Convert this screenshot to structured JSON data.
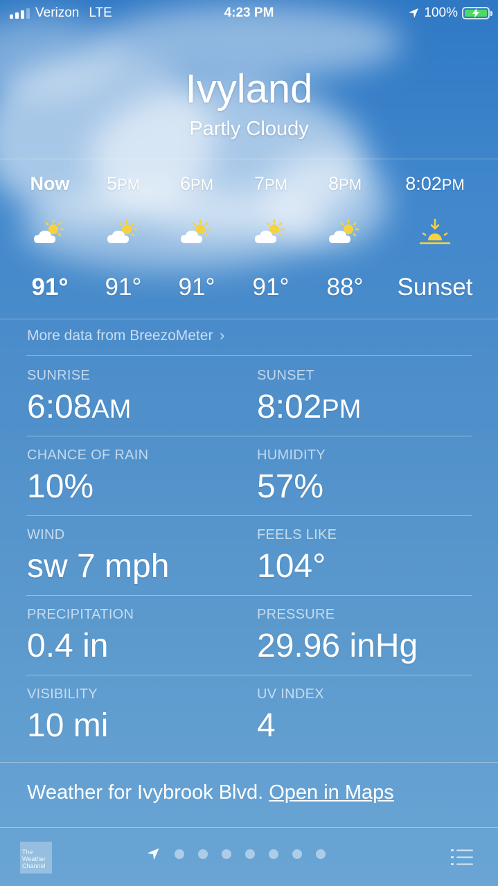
{
  "status_bar": {
    "carrier": "Verizon",
    "network": "LTE",
    "time": "4:23 PM",
    "battery": "100%"
  },
  "location": {
    "city": "Ivyland",
    "condition": "Partly Cloudy"
  },
  "hourly": [
    {
      "time": "Now",
      "temp": "91°",
      "icon": "partly-cloudy-icon"
    },
    {
      "time": "5PM",
      "temp": "91°",
      "icon": "partly-cloudy-icon"
    },
    {
      "time": "6PM",
      "temp": "91°",
      "icon": "partly-cloudy-icon"
    },
    {
      "time": "7PM",
      "temp": "91°",
      "icon": "partly-cloudy-icon"
    },
    {
      "time": "8PM",
      "temp": "88°",
      "icon": "partly-cloudy-icon"
    },
    {
      "time": "8:02PM",
      "temp": "Sunset",
      "icon": "sunset-icon"
    }
  ],
  "breezometer_link": "More data from BreezoMeter",
  "details": {
    "sunrise": {
      "label": "SUNRISE",
      "value": "6:08AM"
    },
    "sunset": {
      "label": "SUNSET",
      "value": "8:02PM"
    },
    "chance_of_rain": {
      "label": "CHANCE OF RAIN",
      "value": "10%"
    },
    "humidity": {
      "label": "HUMIDITY",
      "value": "57%"
    },
    "wind": {
      "label": "WIND",
      "value": "sw 7 mph"
    },
    "feels_like": {
      "label": "FEELS LIKE",
      "value": "104°"
    },
    "precipitation": {
      "label": "PRECIPITATION",
      "value": "0.4 in"
    },
    "pressure": {
      "label": "PRESSURE",
      "value": "29.96 inHg"
    },
    "visibility": {
      "label": "VISIBILITY",
      "value": "10 mi"
    },
    "uv_index": {
      "label": "UV INDEX",
      "value": "4"
    }
  },
  "footer": {
    "weather_for": "Weather for Ivybrook Blvd.",
    "open_in_maps": "Open in Maps"
  },
  "bottom_bar": {
    "logo_text": "The Weather Channel",
    "page_count": 8,
    "active_page": 0
  },
  "colors": {
    "sky_top": "#2f78c4",
    "sky_bottom": "#6aa5d4",
    "sun": "#f7d23e",
    "battery": "#4cd964"
  }
}
